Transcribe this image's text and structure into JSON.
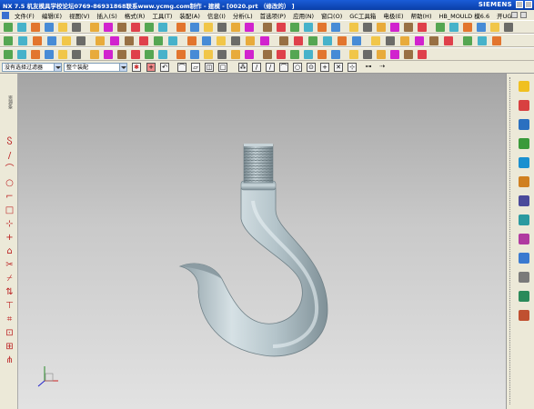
{
  "window": {
    "title": "NX 7.5 机友模具学校论坛0769-86931868联系www.ycmg.com制作 - 建模 - [0020.prt （修改的） ]",
    "brand": "SIEMENS"
  },
  "menu": {
    "items": [
      "文件(F)",
      "编辑(E)",
      "视图(V)",
      "插入(S)",
      "格式(R)",
      "工具(T)",
      "装配(A)",
      "信息(I)",
      "分析(L)",
      "首选项(P)",
      "应用(N)",
      "窗口(O)",
      "GC工具箱",
      "电极(E)",
      "帮助(H)",
      "HB_MOULD 模6.6",
      "开UG"
    ]
  },
  "selection_bar": {
    "filter_value": "没有选择过滤器",
    "scope_value": "整个装配"
  },
  "colors": {
    "title_bar": "#0a3fa8",
    "toolbar_bg": "#ece9d8",
    "viewport_top": "#a4a4a4",
    "viewport_bottom": "#e2e2e2",
    "hook_body": "#b4c4ca",
    "thread": "#9aabb2"
  },
  "model": {
    "name": "hook-model"
  }
}
